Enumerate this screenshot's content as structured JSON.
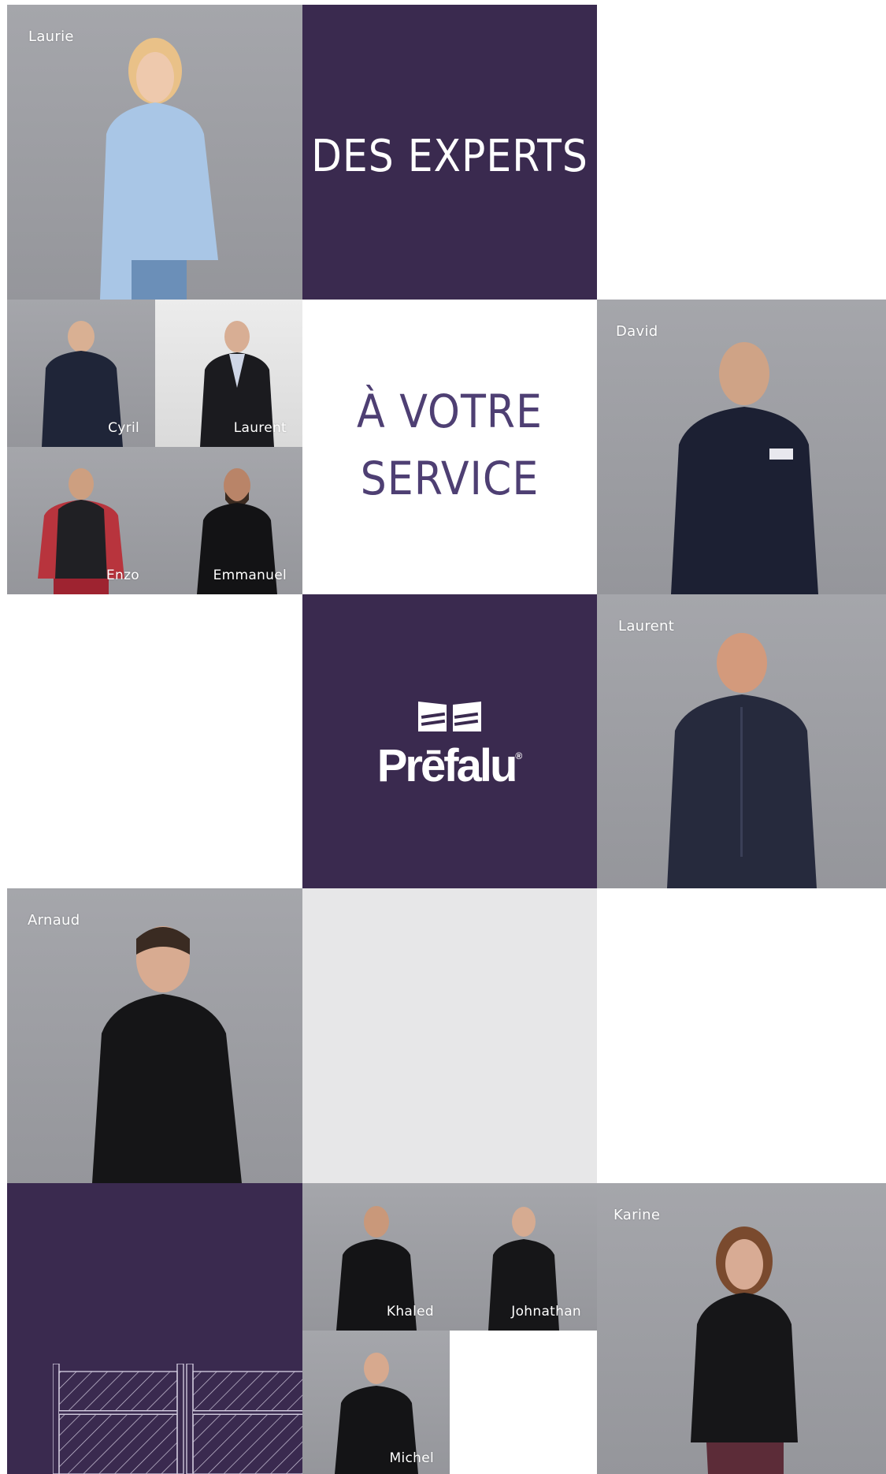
{
  "headlines": {
    "line1": "DES EXPERTS",
    "line2a": "À VOTRE",
    "line2b": "SERVICE"
  },
  "brand": {
    "name": "Prēfalu",
    "registered_mark": "®"
  },
  "team": {
    "laurie": "Laurie",
    "cyril": "Cyril",
    "laurent_small": "Laurent",
    "enzo": "Enzo",
    "emmanuel": "Emmanuel",
    "david": "David",
    "laurent_large": "Laurent",
    "arnaud": "Arnaud",
    "khaled": "Khaled",
    "johnathan": "Johnathan",
    "michel": "Michel",
    "karine": "Karine"
  },
  "colors": {
    "brand_purple": "#3a2a4f",
    "accent_text": "#4e3f73",
    "photo_grey": "#9c9da2",
    "panel_grey": "#e7e7e8"
  },
  "icons": [
    "prefalu-logo-icon",
    "gate-illustration-icon"
  ]
}
